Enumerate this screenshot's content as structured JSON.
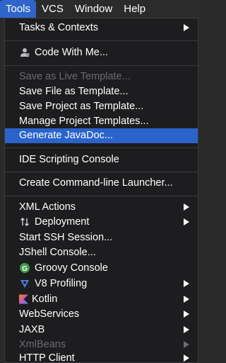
{
  "menubar": {
    "items": [
      {
        "label": "Tools"
      },
      {
        "label": "VCS"
      },
      {
        "label": "Window"
      },
      {
        "label": "Help"
      }
    ]
  },
  "menu": {
    "tasks_contexts": "Tasks & Contexts",
    "code_with_me": "Code With Me...",
    "save_live_template": "Save as Live Template...",
    "save_file_template": "Save File as Template...",
    "save_project_template": "Save Project as Template...",
    "manage_project_templates": "Manage Project Templates...",
    "generate_javadoc": "Generate JavaDoc...",
    "ide_scripting_console": "IDE Scripting Console",
    "create_cli_launcher": "Create Command-line Launcher...",
    "xml_actions": "XML Actions",
    "deployment": "Deployment",
    "start_ssh_session": "Start SSH Session...",
    "jshell_console": "JShell Console...",
    "groovy_console": "Groovy Console",
    "v8_profiling": "V8 Profiling",
    "kotlin": "Kotlin",
    "webservices": "WebServices",
    "jaxb": "JAXB",
    "xmlbeans": "XmlBeans",
    "http_client": "HTTP Client"
  },
  "colors": {
    "accent": "#2b63cb",
    "menu_background": "#1d1d1f",
    "disabled_text": "#6b6b6e"
  },
  "icons": {
    "code_with_me": "person-icon",
    "deployment": "up-down-arrows-icon",
    "groovy_console": "groovy-icon",
    "v8_profiling": "v8-icon",
    "kotlin": "kotlin-icon"
  }
}
